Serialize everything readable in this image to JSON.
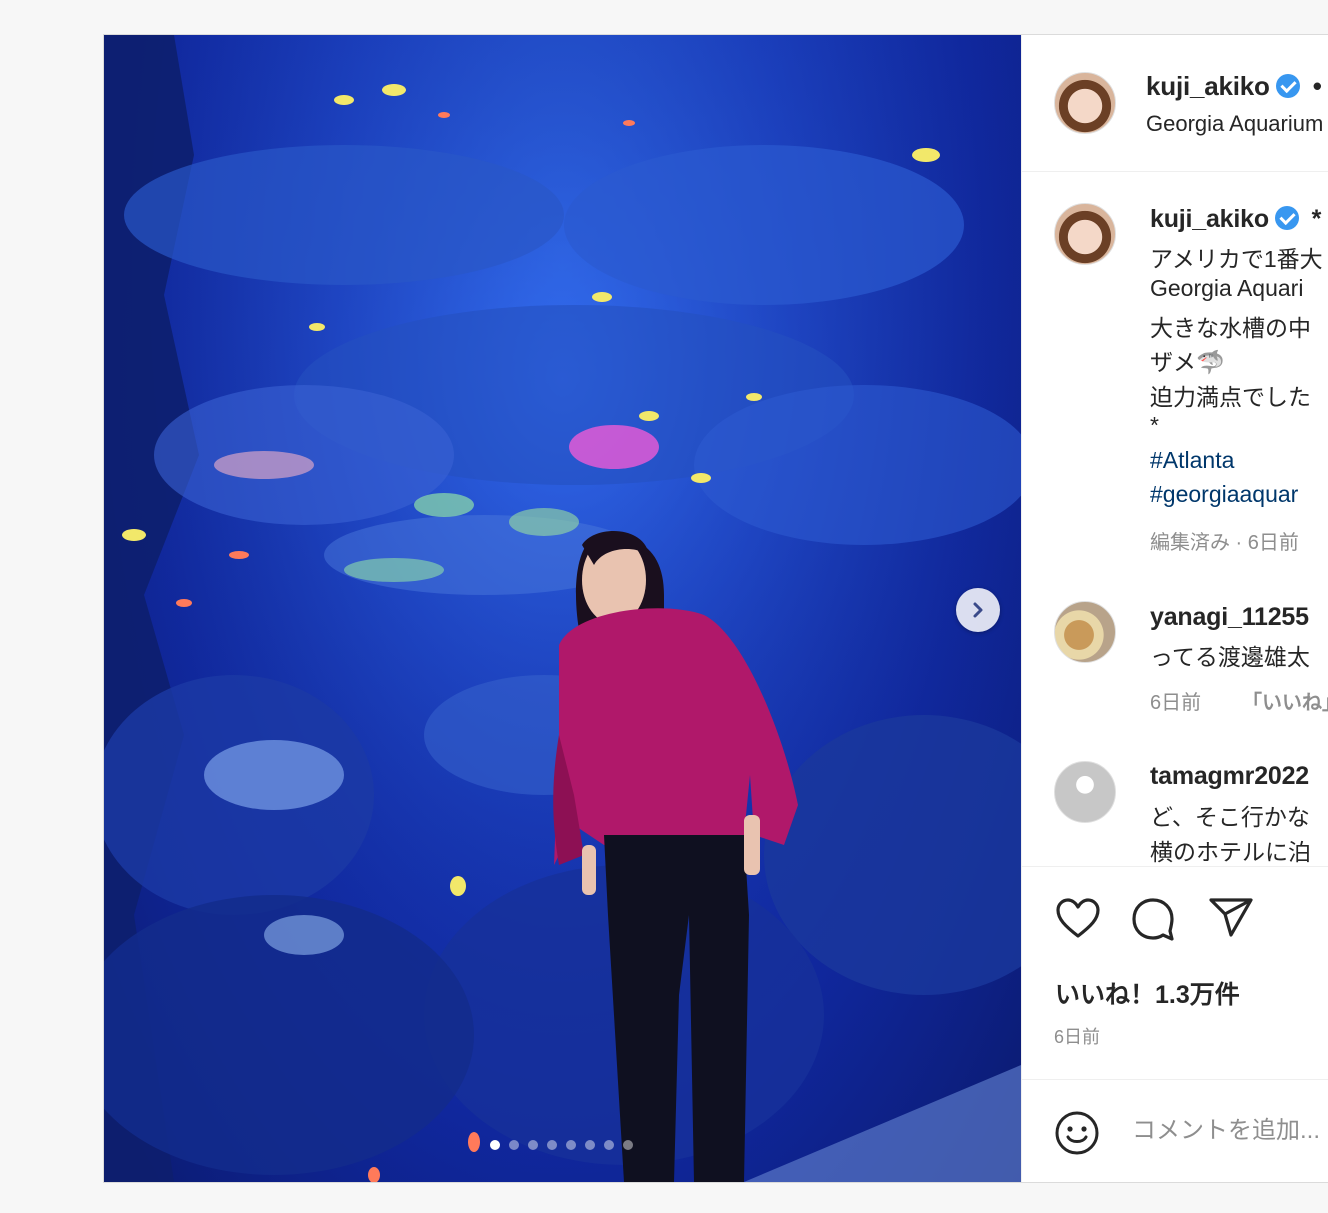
{
  "header": {
    "username": "kuji_akiko",
    "separator": "•",
    "location": "Georgia Aquarium"
  },
  "media": {
    "next_icon": "chevron-right-icon",
    "slide_count": 8,
    "active_slide": 1
  },
  "caption": {
    "username": "kuji_akiko",
    "lines": [
      "アメリカで1番大",
      "Georgia Aquari",
      "大きな水槽の中",
      "ザメ🦈",
      "迫力満点でした",
      "*"
    ],
    "hashtags": [
      "#Atlanta",
      "#georgiaaquar"
    ],
    "meta": "編集済み · 6日前",
    "star": "*"
  },
  "comments": [
    {
      "username": "yanagi_11255",
      "text": "ってる渡邊雄太",
      "time": "6日前",
      "like_label": "「いいね」"
    },
    {
      "username": "tamagmr2022",
      "lines": [
        "ど、そこ行かな",
        "横のホテルに泊"
      ]
    }
  ],
  "actions": {
    "like_icon": "heart-icon",
    "comment_icon": "comment-icon",
    "share_icon": "send-icon",
    "likes_text": "いいね！1.3万件",
    "date": "6日前"
  },
  "comment_box": {
    "emoji_icon": "smiley-icon",
    "placeholder": "コメントを追加..."
  },
  "colors": {
    "link": "#00376b",
    "muted": "#8e8e8e",
    "verified": "#3897f0",
    "water": "#1a3fc4",
    "sweater": "#b0186a"
  }
}
